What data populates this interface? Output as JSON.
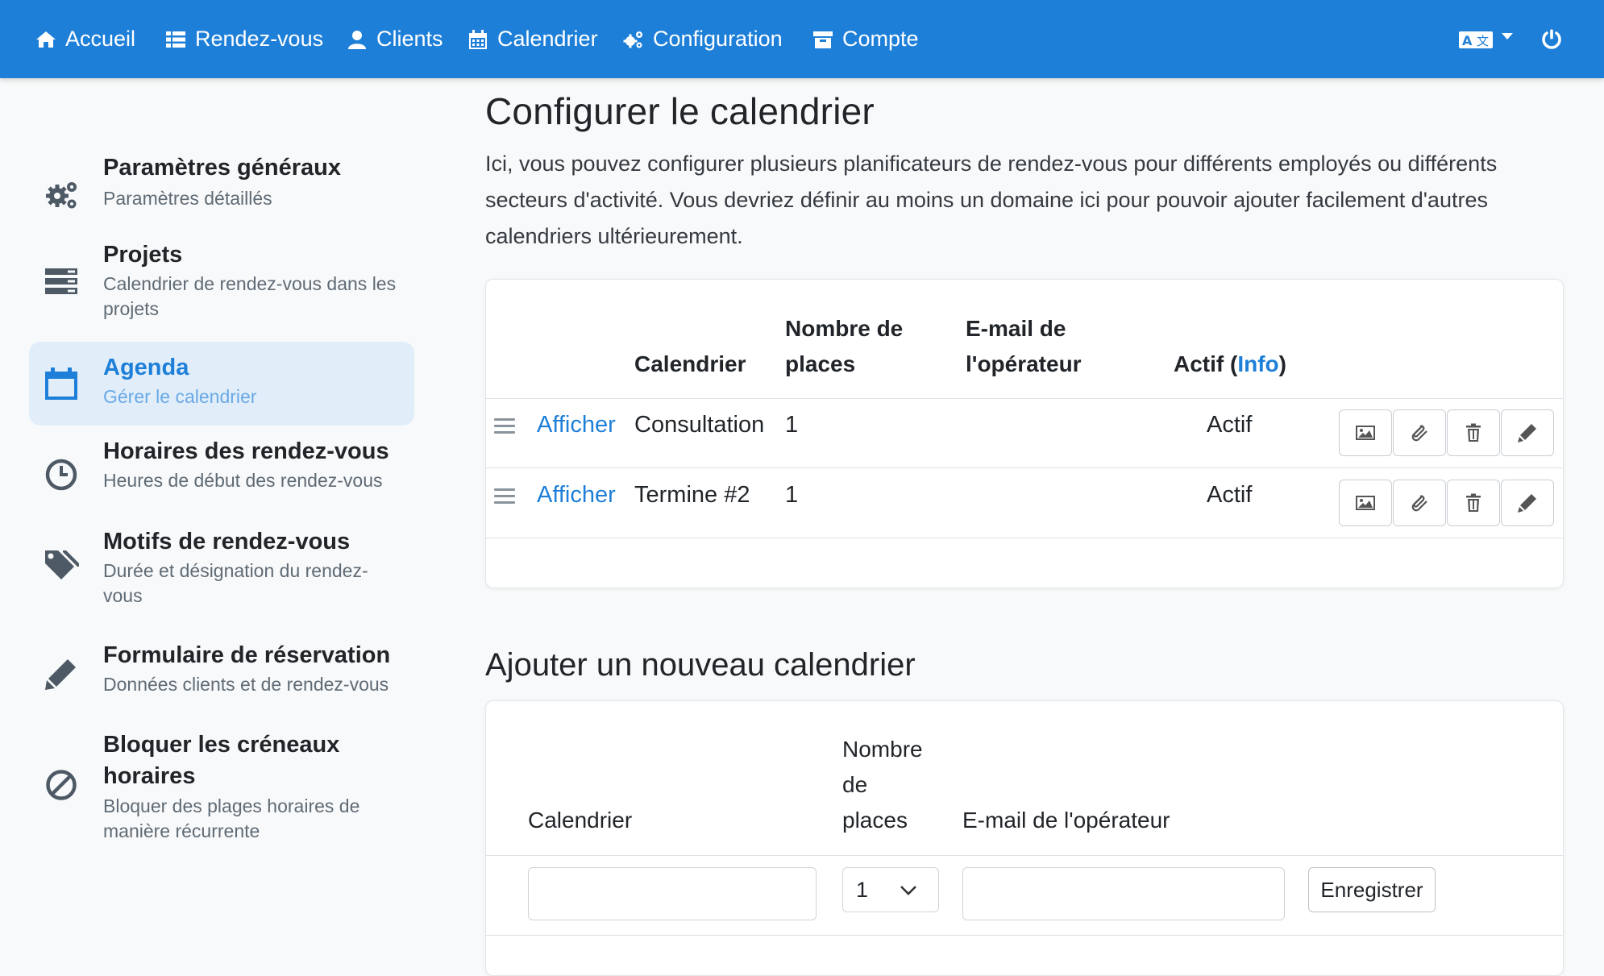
{
  "nav": {
    "items": [
      {
        "label": "Accueil",
        "icon": "home-icon"
      },
      {
        "label": "Rendez-vous",
        "icon": "list-icon"
      },
      {
        "label": "Clients",
        "icon": "user-icon"
      },
      {
        "label": "Calendrier",
        "icon": "calendar-icon"
      },
      {
        "label": "Configuration",
        "icon": "cogs-icon"
      },
      {
        "label": "Compte",
        "icon": "archive-icon"
      }
    ],
    "language_icon": "language-icon",
    "power_icon": "power-icon"
  },
  "sidebar": {
    "items": [
      {
        "title": "Paramètres généraux",
        "subtitle": "Paramètres détaillés",
        "icon": "cogs-icon",
        "active": false
      },
      {
        "title": "Projets",
        "subtitle": "Calendrier de rendez-vous dans les projets",
        "icon": "server-icon",
        "active": false
      },
      {
        "title": "Agenda",
        "subtitle": "Gérer le calendrier",
        "icon": "calendar-icon",
        "active": true
      },
      {
        "title": "Horaires des rendez-vous",
        "subtitle": "Heures de début des rendez-vous",
        "icon": "clock-icon",
        "active": false
      },
      {
        "title": "Motifs de rendez-vous",
        "subtitle": "Durée et désignation du rendez-vous",
        "icon": "tags-icon",
        "active": false
      },
      {
        "title": "Formulaire de réservation",
        "subtitle": "Données clients et de rendez-vous",
        "icon": "pencil-icon",
        "active": false
      },
      {
        "title": "Bloquer les créneaux horaires",
        "subtitle": "Bloquer des plages horaires de manière récurrente",
        "icon": "ban-icon",
        "active": false
      }
    ]
  },
  "main": {
    "title": "Configurer le calendrier",
    "intro": "Ici, vous pouvez configurer plusieurs planificateurs de rendez-vous pour différents employés ou différents secteurs d'activité. Vous devriez définir au moins un domaine ici pour pouvoir ajouter facilement d'autres calendriers ultérieurement.",
    "table": {
      "headers": {
        "calendar": "Calendrier",
        "places_1": "Nombre de",
        "places_2": "places",
        "email_1": "E-mail de",
        "email_2": "l'opérateur",
        "active": "Actif (",
        "info": "Info",
        "active_close": ")"
      },
      "rows": [
        {
          "link": "Afficher",
          "calendar": "Consultation",
          "places": "1",
          "email": "",
          "status": "Actif"
        },
        {
          "link": "Afficher",
          "calendar": "Termine #2",
          "places": "1",
          "email": "",
          "status": "Actif"
        }
      ],
      "row_action_icons": [
        "image-icon",
        "paperclip-icon",
        "trash-icon",
        "pencil-icon"
      ]
    },
    "add": {
      "title": "Ajouter un nouveau calendrier",
      "headers": {
        "calendar": "Calendrier",
        "places_1": "Nombre",
        "places_2": "de",
        "places_3": "places",
        "email": "E-mail de l'opérateur"
      },
      "calendar_value": "",
      "places_value": "1",
      "email_value": "",
      "save_label": "Enregistrer"
    }
  },
  "colors": {
    "primary": "#1e7fd8",
    "active_bg": "#e1eefa",
    "background": "#f8f9fa"
  }
}
